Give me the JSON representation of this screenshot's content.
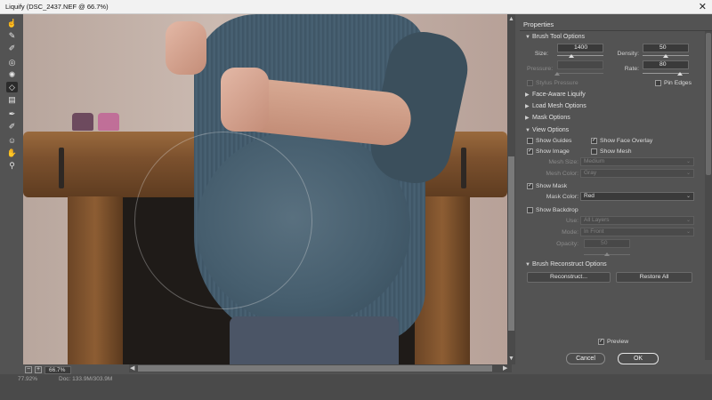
{
  "window": {
    "title": "Liquify (DSC_2437.NEF @ 66.7%)",
    "close_glyph": "✕"
  },
  "tools": [
    {
      "icon": "forward-warp-icon",
      "glyph": "☝"
    },
    {
      "icon": "reconstruct-icon",
      "glyph": "✎"
    },
    {
      "icon": "smooth-icon",
      "glyph": "✐"
    },
    {
      "icon": "twirl-icon",
      "glyph": "◎"
    },
    {
      "icon": "pucker-icon",
      "glyph": "✺"
    },
    {
      "icon": "bloat-icon",
      "glyph": "◇"
    },
    {
      "icon": "push-left-icon",
      "glyph": "▤"
    },
    {
      "icon": "freeze-mask-icon",
      "glyph": "✒"
    },
    {
      "icon": "thaw-mask-icon",
      "glyph": "✐"
    },
    {
      "icon": "face-tool-icon",
      "glyph": "☺"
    },
    {
      "icon": "hand-icon",
      "glyph": "✋"
    },
    {
      "icon": "zoom-icon",
      "glyph": "⚲"
    }
  ],
  "zoom": {
    "minus": "−",
    "plus": "+",
    "value": "66.7%"
  },
  "status": {
    "zoom": "77.92%",
    "doc": "Doc: 133.9M/303.9M"
  },
  "panel": {
    "title": "Properties",
    "brush_tool_options": {
      "header": "Brush Tool Options",
      "size_label": "Size:",
      "size_value": "1400",
      "density_label": "Density:",
      "density_value": "50",
      "pressure_label": "Pressure:",
      "pressure_value": "",
      "rate_label": "Rate:",
      "rate_value": "80",
      "stylus_pressure": "Stylus Pressure",
      "pin_edges": "Pin Edges",
      "levels": {
        "size": 0.3,
        "density": 0.5,
        "pressure": 0.0,
        "rate": 0.8
      }
    },
    "face_aware": {
      "header": "Face-Aware Liquify"
    },
    "load_mesh": {
      "header": "Load Mesh Options"
    },
    "mask_options": {
      "header": "Mask Options"
    },
    "view_options": {
      "header": "View Options",
      "show_guides": "Show Guides",
      "show_face_overlay": "Show Face Overlay",
      "show_image": "Show Image",
      "show_mesh": "Show Mesh",
      "mesh_size_label": "Mesh Size:",
      "mesh_size_value": "Medium",
      "mesh_color_label": "Mesh Color:",
      "mesh_color_value": "Gray",
      "show_mask": "Show Mask",
      "mask_color_label": "Mask Color:",
      "mask_color_value": "Red",
      "show_backdrop": "Show Backdrop",
      "use_label": "Use:",
      "use_value": "All Layers",
      "mode_label": "Mode:",
      "mode_value": "In Front",
      "opacity_label": "Opacity:",
      "opacity_value": "50"
    },
    "brush_reconstruct": {
      "header": "Brush Reconstruct Options",
      "reconstruct_button": "Reconstruct...",
      "restore_all_button": "Restore All"
    },
    "preview_label": "Preview",
    "cancel_button": "Cancel",
    "ok_button": "OK"
  },
  "colors": {
    "accent": "#535353",
    "canvas_bg": "#b9a79e",
    "panel_bg": "#535353"
  }
}
